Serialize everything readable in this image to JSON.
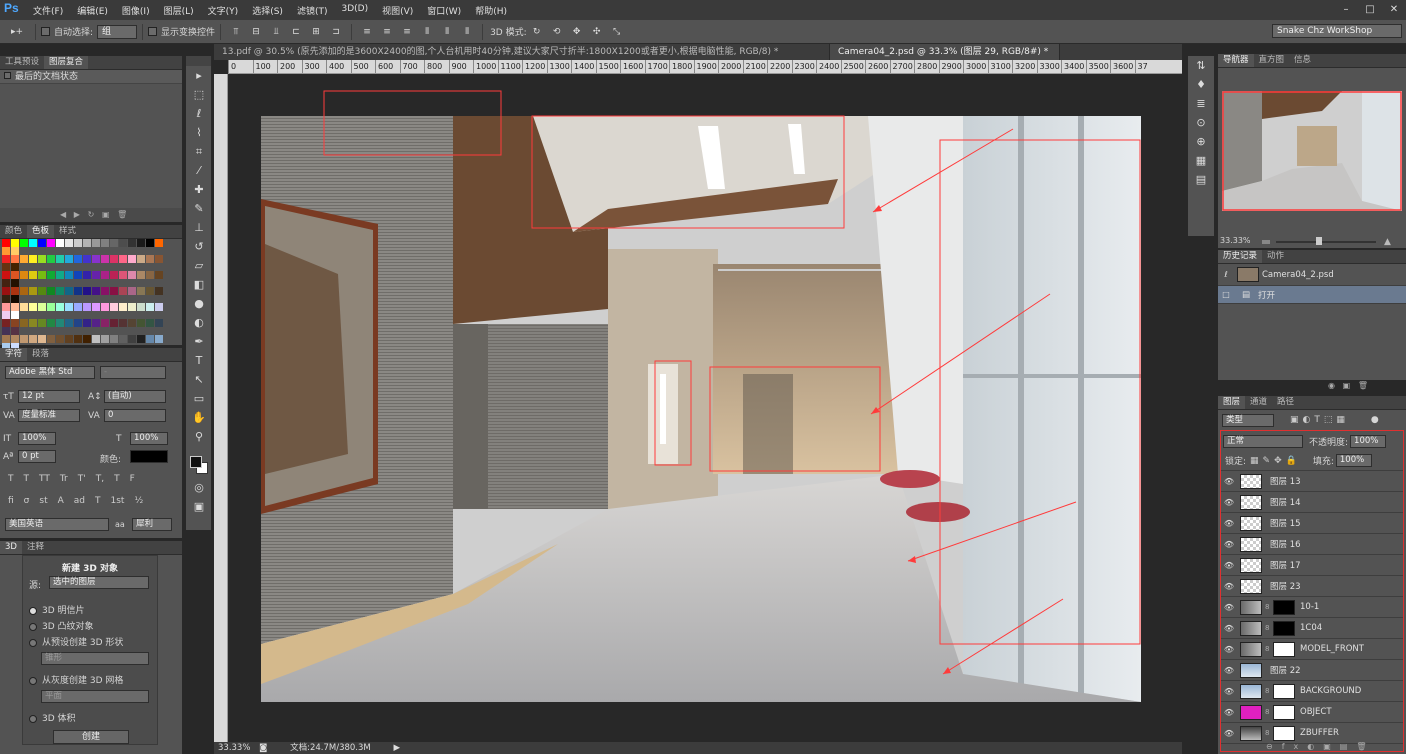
{
  "app": {
    "logo": "Ps"
  },
  "menu": [
    "文件(F)",
    "编辑(E)",
    "图像(I)",
    "图层(L)",
    "文字(Y)",
    "选择(S)",
    "滤镜(T)",
    "3D(D)",
    "视图(V)",
    "窗口(W)",
    "帮助(H)"
  ],
  "options_bar": {
    "auto_select_label": "自动选择:",
    "auto_select_value": "组",
    "show_transform_label": "显示变换控件",
    "mode_3d_label": "3D 模式:",
    "workspace": "Snake Chz WorkShop"
  },
  "doc_tabs": [
    {
      "label": "13.pdf @ 30.5% (原先添加的是3600X2400的图,个人台机用时40分钟,建议大家尺寸折半:1800X1200或者更小,根据电脑性能, RGB/8) *",
      "active": false
    },
    {
      "label": "Camera04_2.psd @ 33.3% (图层 29, RGB/8#) *",
      "active": true
    }
  ],
  "ruler_ticks": [
    "0",
    "100",
    "200",
    "300",
    "400",
    "500",
    "600",
    "700",
    "800",
    "900",
    "1000",
    "1100",
    "1200",
    "1300",
    "1400",
    "1500",
    "1600",
    "1700",
    "1800",
    "1900",
    "2000",
    "2100",
    "2200",
    "2300",
    "2400",
    "2500",
    "2600",
    "2700",
    "2800",
    "2900",
    "3000",
    "3100",
    "3200",
    "3300",
    "3400",
    "3500",
    "3600",
    "37"
  ],
  "status": {
    "zoom": "33.33%",
    "doc": "文档:24.7M/380.3M"
  },
  "left_top_panel": {
    "tabs": [
      "工具预设",
      "图层复合"
    ],
    "item": "最后的文档状态"
  },
  "color_panel": {
    "tabs": [
      "颜色",
      "色板",
      "样式"
    ]
  },
  "char_panel": {
    "tabs": [
      "字符",
      "段落"
    ],
    "font": "Adobe 黑体 Std",
    "style": "-",
    "size": "12 pt",
    "leading": "(自动)",
    "kerning": "度量标准",
    "tracking": "0",
    "vscale": "100%",
    "hscale": "100%",
    "baseline": "0 pt",
    "color_label": "颜色:",
    "lang": "美国英语",
    "aa_prefix": "aa",
    "aa": "犀利",
    "styles_row": [
      "T",
      "T",
      "TT",
      "Tr",
      "T'",
      "T,",
      "T",
      "F"
    ],
    "ot_row": [
      "fi",
      "σ",
      "st",
      "A",
      "ad",
      "T",
      "1st",
      "½"
    ]
  },
  "panel3d": {
    "tabs": [
      "3D",
      "注释"
    ],
    "title": "新建 3D 对象",
    "source_label": "源:",
    "source_value": "选中的图层",
    "opt1": "3D 明信片",
    "opt2": "3D 凸纹对象",
    "opt3": "从预设创建 3D 形状",
    "preset1": "锥形",
    "opt4": "从灰度创建 3D 网格",
    "preset2": "平面",
    "opt5": "3D 体积",
    "create": "创建"
  },
  "navigator": {
    "tabs": [
      "导航器",
      "直方图",
      "信息"
    ],
    "zoom": "33.33%"
  },
  "history": {
    "tabs": [
      "历史记录",
      "动作"
    ],
    "items": [
      "Camera04_2.psd",
      "打开"
    ]
  },
  "layers": {
    "tabs": [
      "图层",
      "通道",
      "路径"
    ],
    "filter": "类型",
    "blend": "正常",
    "opacity_label": "不透明度:",
    "opacity": "100%",
    "lock_label": "锁定:",
    "fill_label": "填充:",
    "fill": "100%",
    "rows": [
      {
        "name": "图层 13",
        "thumb": "check",
        "mask": ""
      },
      {
        "name": "图层 14",
        "thumb": "check",
        "mask": ""
      },
      {
        "name": "图层 15",
        "thumb": "check",
        "mask": ""
      },
      {
        "name": "图层 16",
        "thumb": "check",
        "mask": ""
      },
      {
        "name": "图层 17",
        "thumb": "check",
        "mask": ""
      },
      {
        "name": "图层 23",
        "thumb": "check",
        "mask": ""
      },
      {
        "name": "10-1",
        "thumb": "img",
        "mask": "black"
      },
      {
        "name": "1C04",
        "thumb": "img",
        "mask": "black"
      },
      {
        "name": "MODEL_FRONT",
        "thumb": "img",
        "mask": "white"
      },
      {
        "name": "图层 22",
        "thumb": "sky",
        "mask": ""
      },
      {
        "name": "BACKGROUND",
        "thumb": "sky",
        "mask": "white"
      },
      {
        "name": "OBJECT",
        "thumb": "magenta",
        "mask": "white"
      },
      {
        "name": "ZBUFFER",
        "thumb": "gray",
        "mask": "white"
      }
    ]
  },
  "colors": {
    "accent": "#4ea8ff",
    "annotation": "#ff3b3b",
    "magenta": "#e020c0"
  }
}
